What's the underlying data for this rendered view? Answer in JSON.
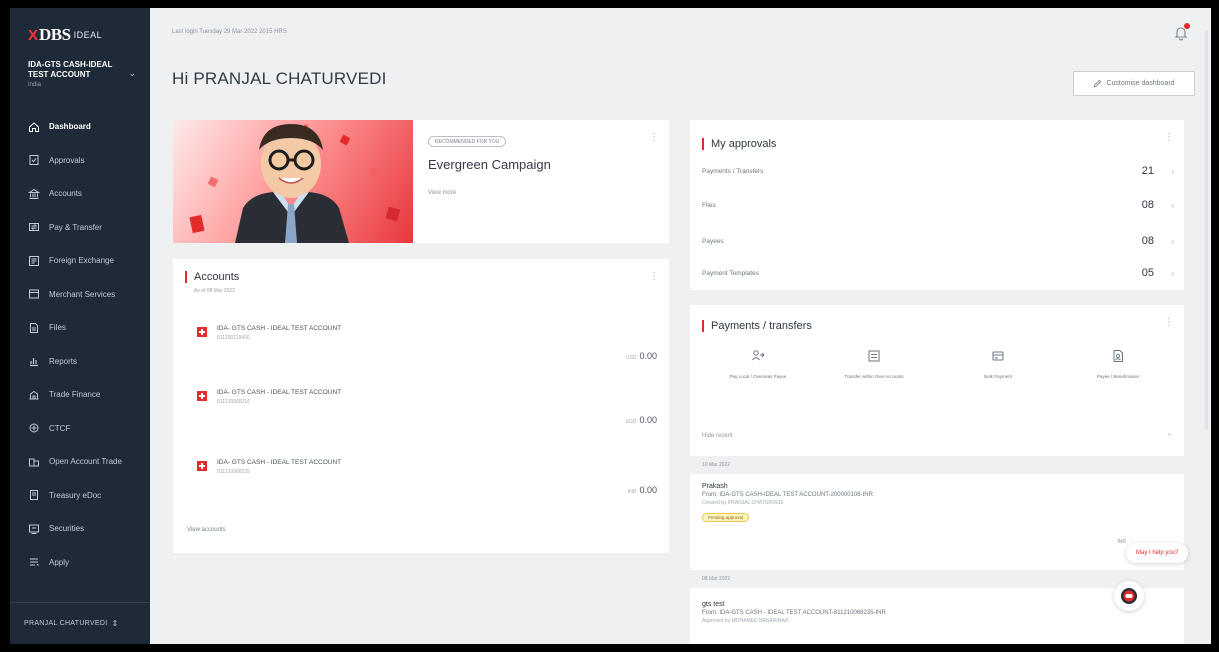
{
  "brand": {
    "logo_x": "X",
    "logo_dbs": "DBS",
    "logo_ideal": "IDEAL"
  },
  "org": {
    "name": "IDA-GTS CASH-IDEAL TEST ACCOUNT",
    "sub": "India"
  },
  "sidebar": {
    "items": [
      {
        "label": "Dashboard",
        "icon": "home-icon"
      },
      {
        "label": "Approvals",
        "icon": "approvals-icon"
      },
      {
        "label": "Accounts",
        "icon": "accounts-icon"
      },
      {
        "label": "Pay & Transfer",
        "icon": "transfer-icon"
      },
      {
        "label": "Foreign Exchange",
        "icon": "fx-icon"
      },
      {
        "label": "Merchant Services",
        "icon": "merchant-icon"
      },
      {
        "label": "Files",
        "icon": "files-icon"
      },
      {
        "label": "Reports",
        "icon": "reports-icon"
      },
      {
        "label": "Trade Finance",
        "icon": "trade-icon"
      },
      {
        "label": "CTCF",
        "icon": "ctcf-icon"
      },
      {
        "label": "Open Account Trade",
        "icon": "open-account-icon"
      },
      {
        "label": "Treasury eDoc",
        "icon": "treasury-icon"
      },
      {
        "label": "Securities",
        "icon": "securities-icon"
      },
      {
        "label": "Apply",
        "icon": "apply-icon"
      }
    ],
    "footer_user": "PRANJAL CHATURVEDI"
  },
  "header": {
    "last_login": "Last login Tuesday 29 Mar 2022 2015 HRS",
    "greeting": "Hi PRANJAL CHATURVEDI",
    "customize": "Customise dashboard"
  },
  "campaign": {
    "tag": "RECOMMENDED FOR YOU",
    "title": "Evergreen Campaign",
    "link": "View more"
  },
  "accounts": {
    "title": "Accounts",
    "as_of": "As of 08 Mar 2022",
    "rows": [
      {
        "name": "IDA- GTS CASH - IDEAL TEST ACCOUNT",
        "number": "811200119400",
        "ccy": "USD",
        "balance": "0.00"
      },
      {
        "name": "IDA- GTS CASH - IDEAL TEST ACCOUNT",
        "number": "811210068216",
        "ccy": "SGD",
        "balance": "0.00"
      },
      {
        "name": "IDA- GTS CASH - IDEAL TEST ACCOUNT",
        "number": "811210068235",
        "ccy": "INR",
        "balance": "0.00"
      }
    ],
    "view_all": "View accounts"
  },
  "approvals": {
    "title": "My approvals",
    "rows": [
      {
        "label": "Payments / Transfers",
        "count": "21"
      },
      {
        "label": "Files",
        "count": "08"
      },
      {
        "label": "Payees",
        "count": "08"
      },
      {
        "label": "Payment Templates",
        "count": "05"
      }
    ]
  },
  "payments": {
    "title": "Payments / transfers",
    "quick": [
      {
        "label": "Pay Local / Overseas Payee",
        "icon": "pay-payee-icon"
      },
      {
        "label": "Transfer within Own Accounts",
        "icon": "own-transfer-icon"
      },
      {
        "label": "Bulk Payment",
        "icon": "bulk-payment-icon"
      },
      {
        "label": "Payee / Beneficiaries",
        "icon": "payee-icon"
      }
    ],
    "hide_recent": "Hide recent",
    "groups": [
      {
        "date": "10 Mar 2022",
        "name": "Prakash",
        "from": "From: IDA-GTS CASH-IDEAL TEST ACCOUNT-200000108-INR",
        "by": "Created by PRANJAL CHATURVEDI",
        "badge": "Pending approval",
        "amount": "INR"
      },
      {
        "date": "08 Mar 2022",
        "name": "gts test",
        "from": "From: IDA-GTS CASH - IDEAL TEST ACCOUNT-811210068235-INR",
        "by": "Approved by MOHAMED NASARINAR"
      }
    ]
  },
  "help": {
    "bubble": "May I help you?"
  },
  "colors": {
    "sidebar": "#1f2a38",
    "accent": "#e32b2b",
    "background": "#eef0f2"
  }
}
